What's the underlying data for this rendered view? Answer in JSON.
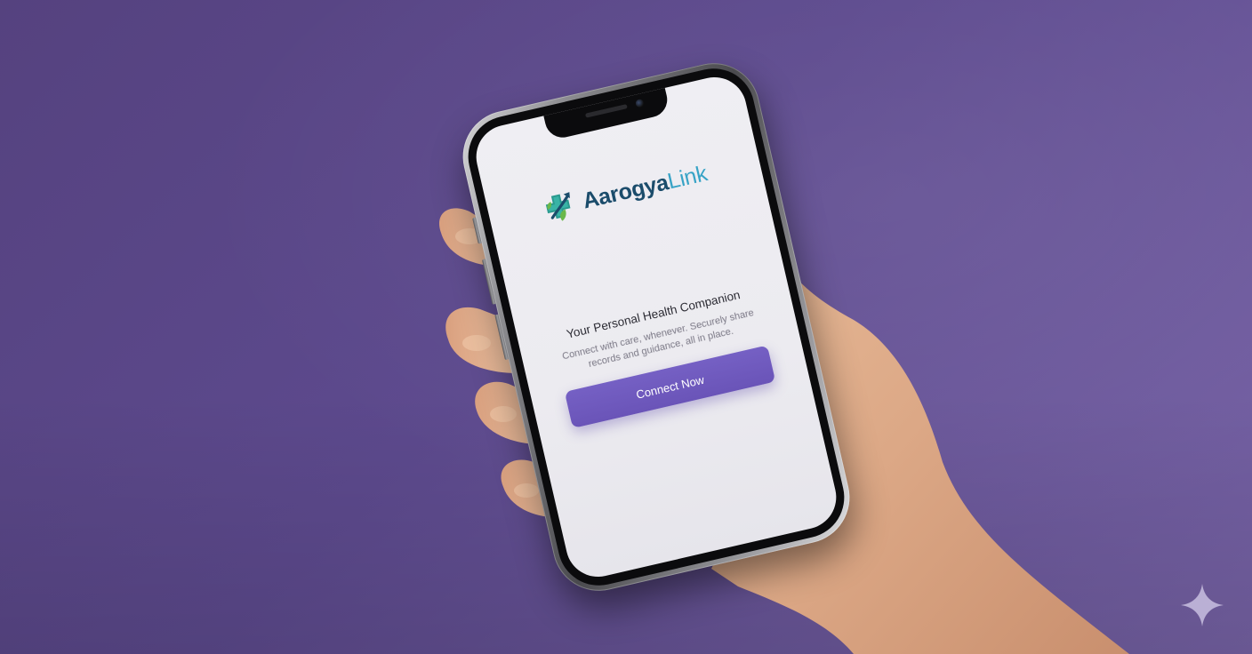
{
  "app": {
    "brand_primary": "Aarogya",
    "brand_secondary": "Link",
    "tagline": "Your Personal Health Companion",
    "description": "Connect with care, whenever. Securely share records and guidance, all in place.",
    "cta_label": "Connect Now"
  },
  "icons": {
    "logo": "medical-cross-arrow-leaf-logo-icon",
    "watermark": "sparkle-icon"
  },
  "colors": {
    "background": "#5d4a8e",
    "brand_dark": "#1b4c6b",
    "brand_light": "#37a3c6",
    "button": "#6a54b8",
    "screen": "#ecebf0"
  }
}
